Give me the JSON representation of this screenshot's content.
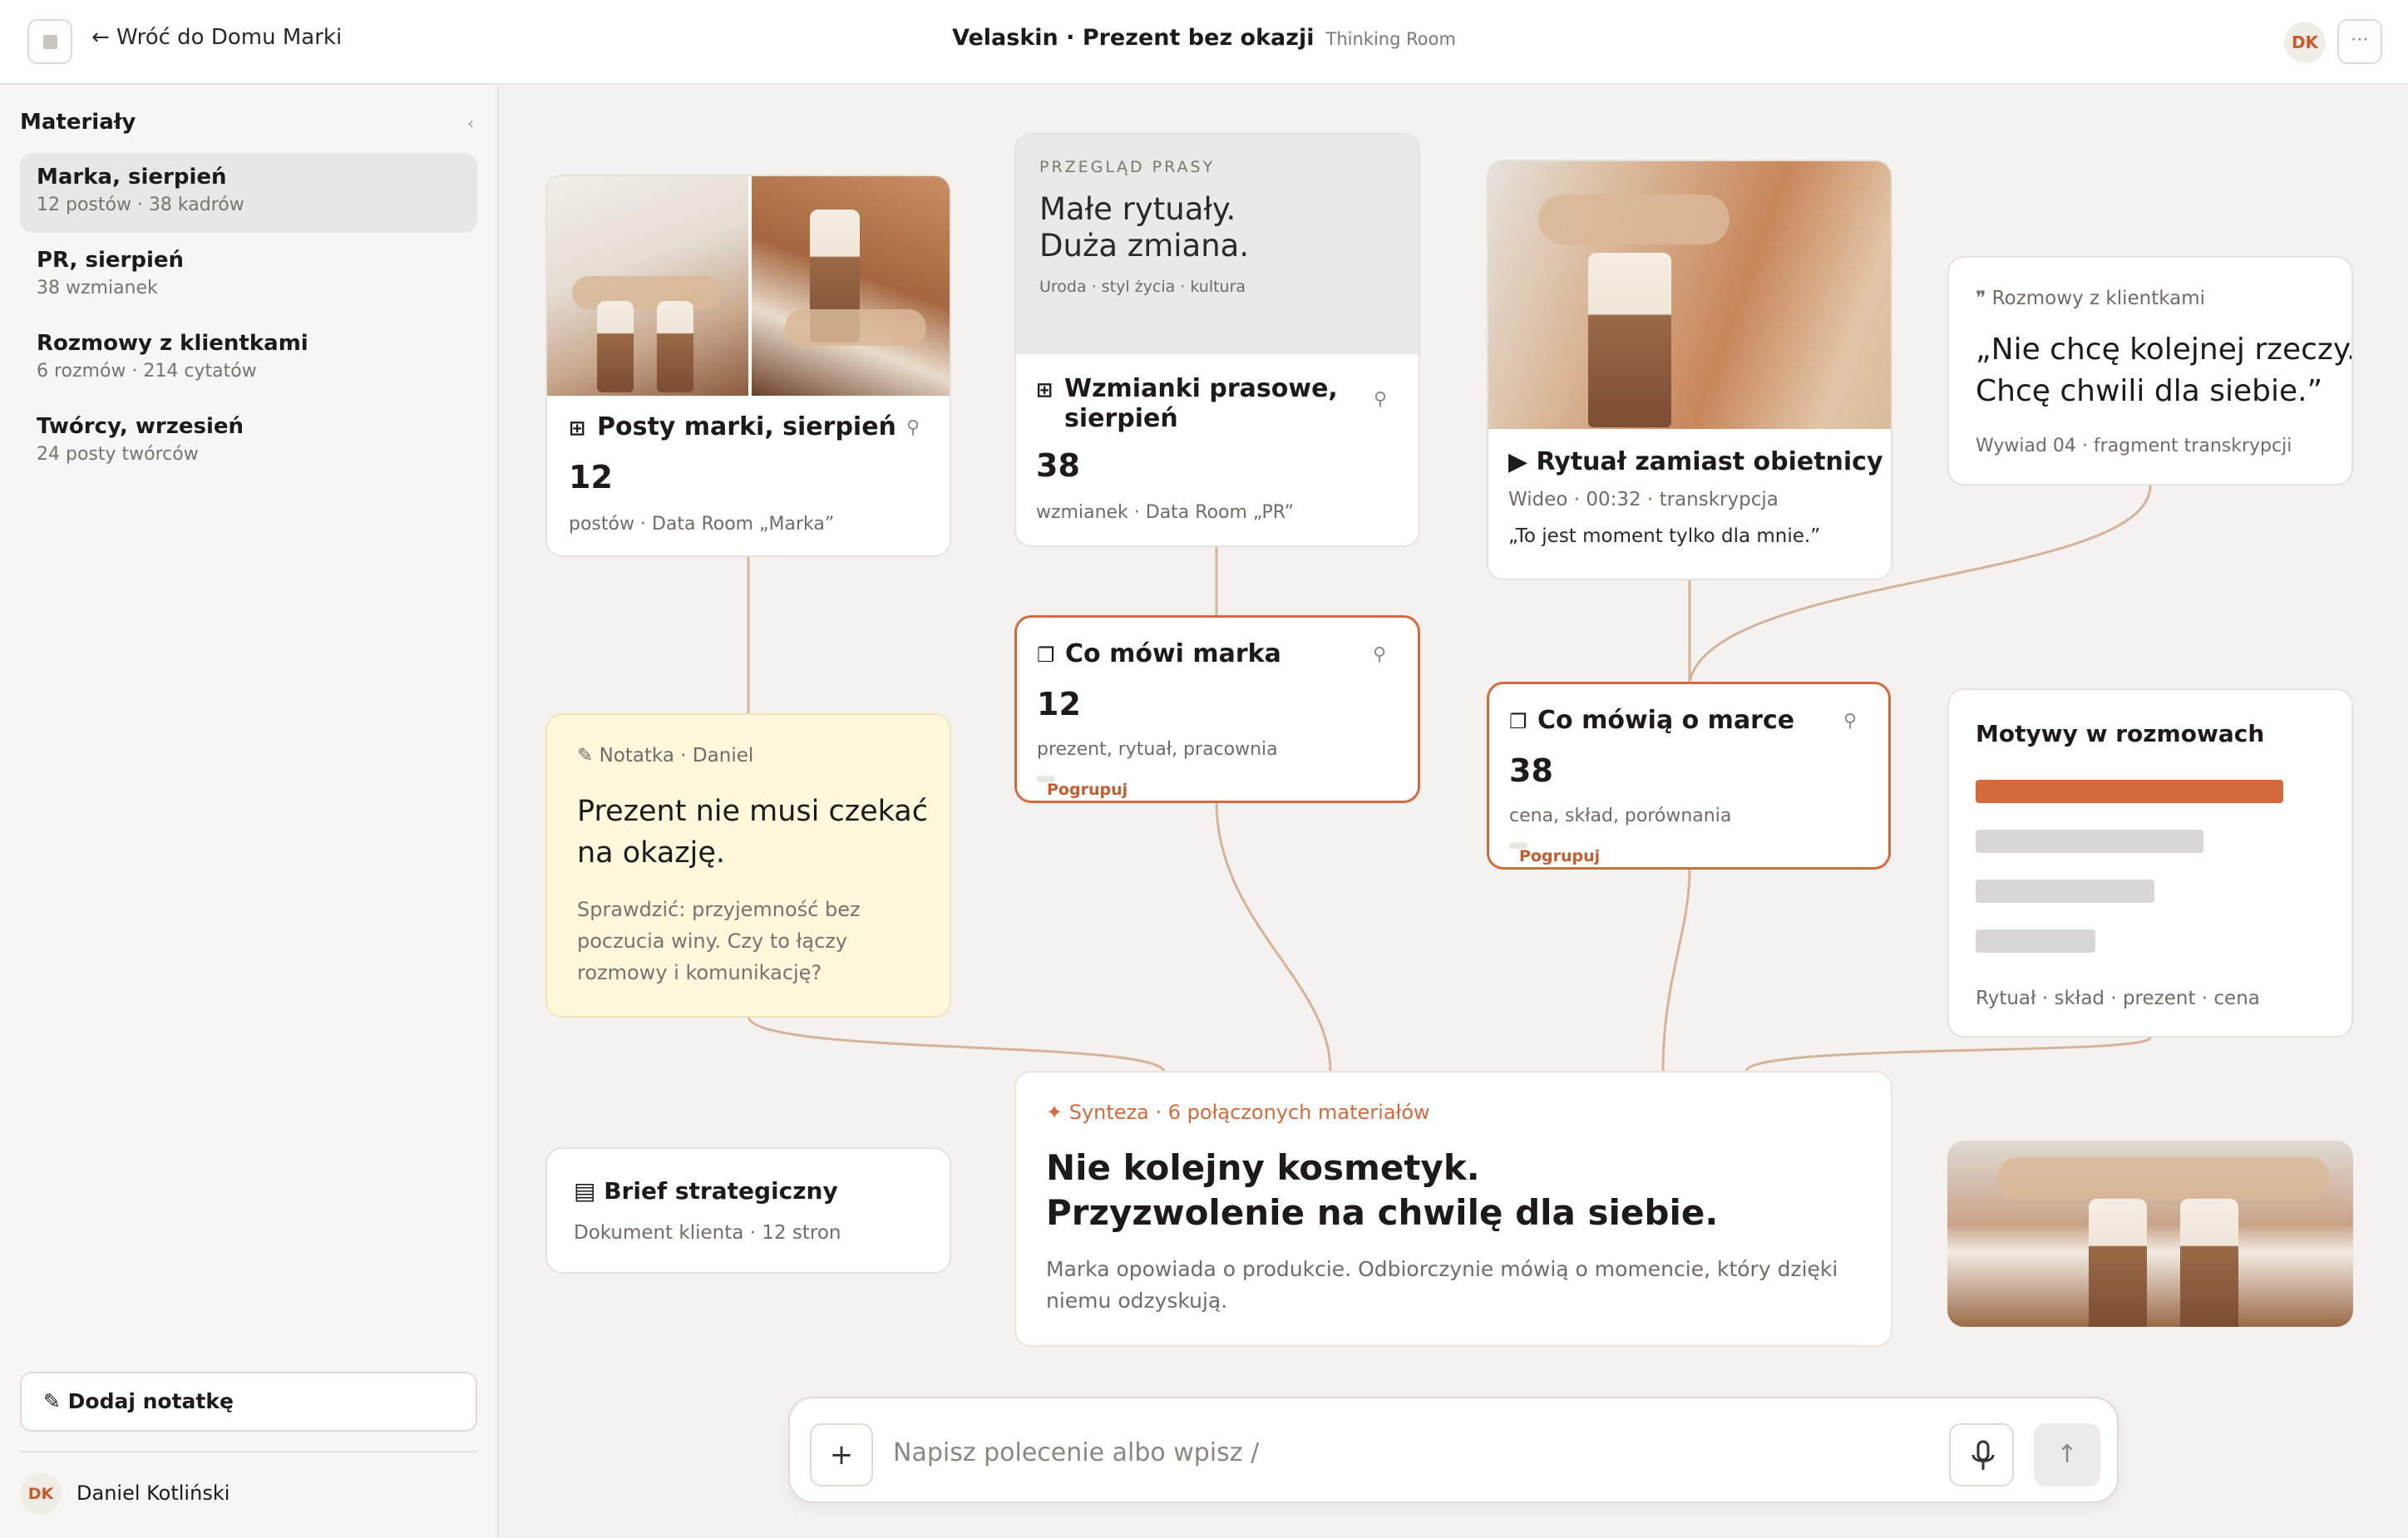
{
  "topbar": {
    "back_label": "← Wróć do Domu Marki",
    "title": "Velaskin · Prezent bez okazji",
    "room": "Thinking Room",
    "avatar_initials": "DK",
    "more_icon": "⋯"
  },
  "sidebar": {
    "heading": "Materiały",
    "collapse_icon": "‹",
    "items": [
      {
        "title": "Marka, sierpień",
        "sub": "12 postów · 38 kadrów"
      },
      {
        "title": "PR, sierpień",
        "sub": "38 wzmianek"
      },
      {
        "title": "Rozmowy z klientkami",
        "sub": "6 rozmów · 214 cytatów"
      },
      {
        "title": "Twórcy, wrzesień",
        "sub": "24 posty twórców"
      }
    ],
    "add_note": "✎ Dodaj notatkę",
    "user_initials": "DK",
    "user_name": "Daniel Kotliński"
  },
  "cards": {
    "posts": {
      "title": "Posty marki, sierpień",
      "count": "12",
      "meta": "postów · Data Room „Marka”"
    },
    "press": {
      "kicker": "PRZEGLĄD PRASY",
      "headline1": "Małe rytuały.",
      "headline2": "Duża zmiana.",
      "tags": "Uroda · styl życia · kultura",
      "title1": "Wzmianki prasowe,",
      "title2": "sierpień",
      "count": "38",
      "meta": "wzmianek · Data Room „PR”"
    },
    "video": {
      "title": "▶ Rytuał zamiast obietnicy",
      "meta": "Wideo · 00:32 · transkrypcja",
      "quote": "„To jest moment tylko dla mnie.”"
    },
    "quote": {
      "source": "❞ Rozmowy z klientkami",
      "text1": "„Nie chcę kolejnej rzeczy.",
      "text2": "Chcę chwili dla siebie.”",
      "meta": "Wywiad 04 · fragment transkrypcji"
    },
    "brand_says": {
      "title": "Co mówi marka",
      "count": "12",
      "meta": "prezent, rytuał, pracownia",
      "group": "Pogrupuj"
    },
    "about_brand": {
      "title": "Co mówią o marce",
      "count": "38",
      "meta": "cena, skład, porównania",
      "group": "Pogrupuj"
    },
    "note": {
      "source": "✎ Notatka · Daniel",
      "text1": "Prezent nie musi czekać",
      "text2": "na okazję.",
      "body1": "Sprawdzić: przyjemność bez",
      "body2": "poczucia winy. Czy to łączy",
      "body3": "rozmowy i komunikację?"
    },
    "motifs": {
      "title": "Motywy w rozmowach",
      "tags": "Rytuał · skład · prezent · cena",
      "bars": [
        {
          "value": 1.0,
          "color": "#d4693b"
        },
        {
          "value": 0.74,
          "color": "#d9d7d3"
        },
        {
          "value": 0.58,
          "color": "#d9d7d3"
        },
        {
          "value": 0.39,
          "color": "#d9d7d3"
        }
      ]
    },
    "brief": {
      "title": "▤ Brief strategiczny",
      "meta": "Dokument klienta · 12 stron"
    },
    "synth": {
      "label": "✦ Synteza · 6 połączonych materiałów",
      "title1": "Nie kolejny kosmetyk.",
      "title2": "Przyzwolenie na chwilę dla siebie.",
      "body1": "Marka opowiada o produkcie. Odbiorczynie mówią o momencie, który dzięki",
      "body2": "niemu odzyskują."
    }
  },
  "composer": {
    "placeholder": "Napisz polecenie albo wpisz /",
    "plus_icon": "+",
    "send_icon": "↑"
  },
  "colors": {
    "accent": "#d4693b",
    "connector": "#d6b29a"
  }
}
